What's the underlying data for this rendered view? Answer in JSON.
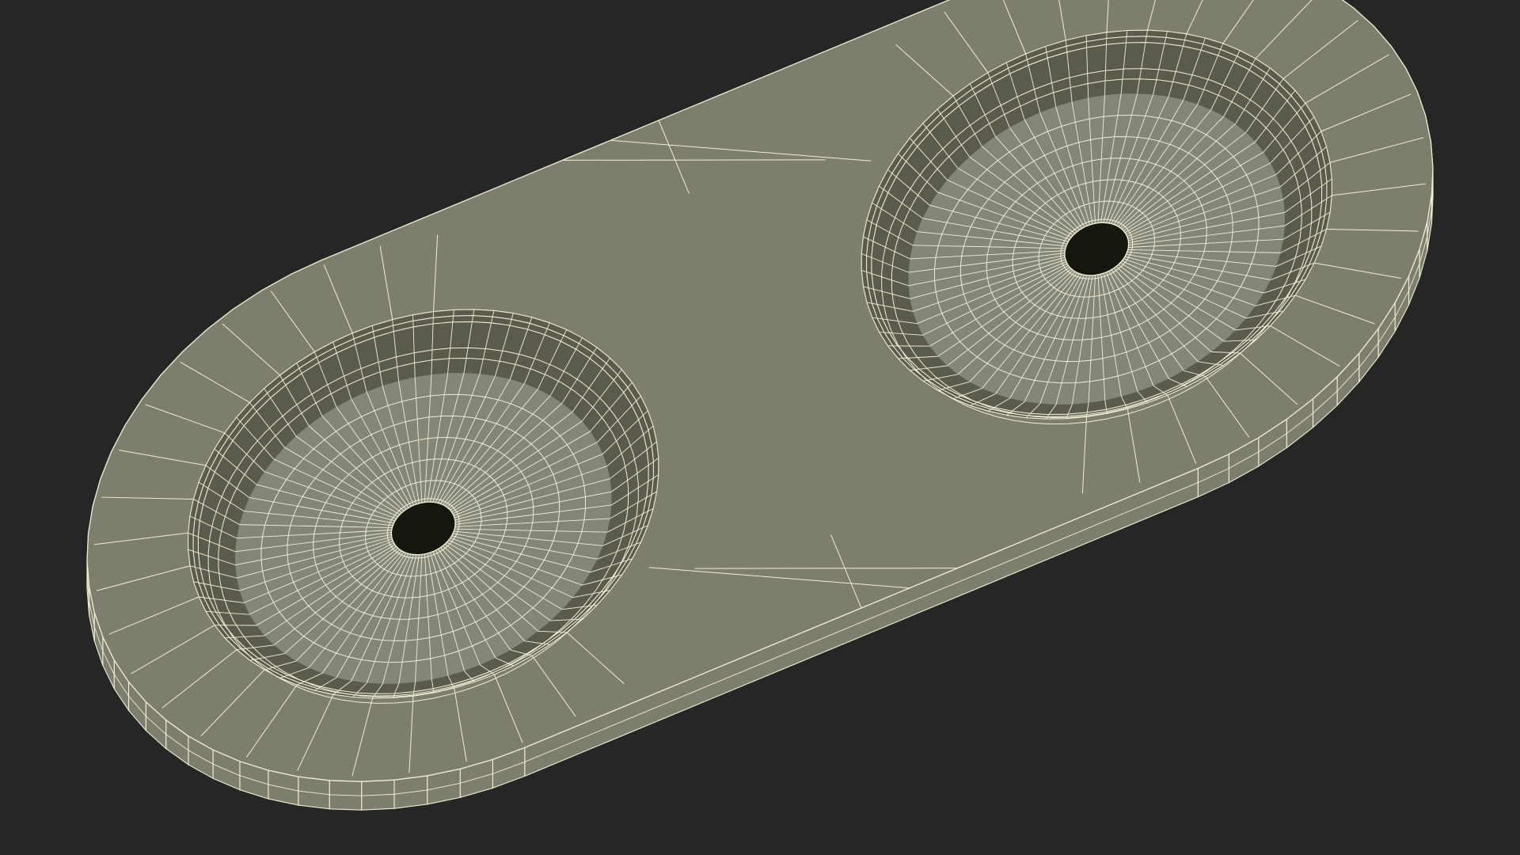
{
  "scene": {
    "subject": "double-basin-tray-wireframe-model",
    "render_style": "wireframe-over-shaded",
    "colors": {
      "background": "#262626",
      "surface": "#7d7e6d",
      "surface_dark": "#5f604f",
      "basin_floor": "#85867a",
      "wall_shade": "#5a5b4c",
      "underside": "#6f705f",
      "wire": "#f1eed6",
      "drain_hole": "#15170f"
    },
    "basins": [
      {
        "name": "left-basin",
        "has_drain_hole": true
      },
      {
        "name": "right-basin",
        "has_drain_hole": true
      }
    ],
    "wire_density": {
      "rim_segments": 64,
      "basin_radial_segments": 72,
      "basin_rings": 5
    }
  }
}
